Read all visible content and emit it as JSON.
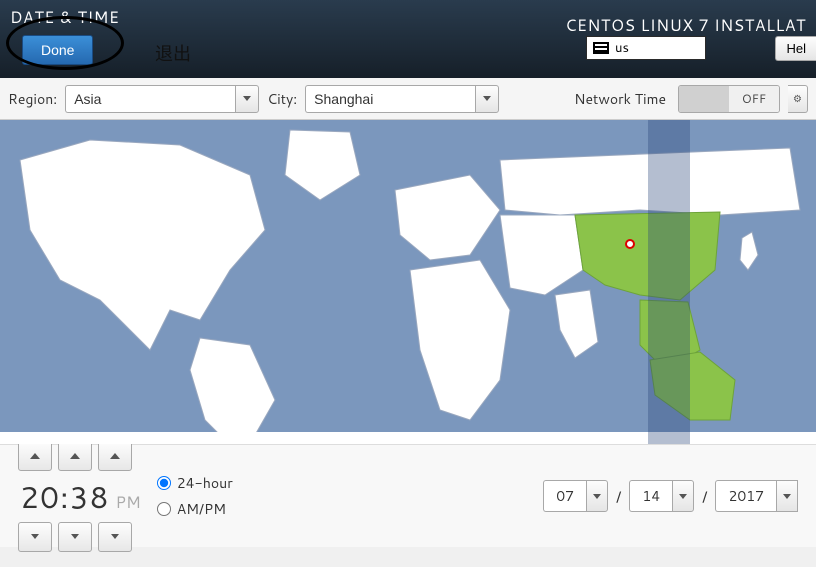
{
  "header": {
    "title": "DATE & TIME",
    "done": "Done",
    "exit_cn": "退出",
    "installer": "CENTOS LINUX 7 INSTALLAT",
    "kb_layout": "us",
    "help": "Hel"
  },
  "controls": {
    "region_label": "Region:",
    "region_value": "Asia",
    "city_label": "City:",
    "city_value": "Shanghai",
    "network_time_label": "Network Time",
    "network_time_state": "OFF"
  },
  "time": {
    "value": "20:38",
    "ampm": "PM",
    "format_24": "24-hour",
    "format_ampm": "AM/PM"
  },
  "date": {
    "month": "07",
    "day": "14",
    "year": "2017",
    "sep": "/"
  }
}
